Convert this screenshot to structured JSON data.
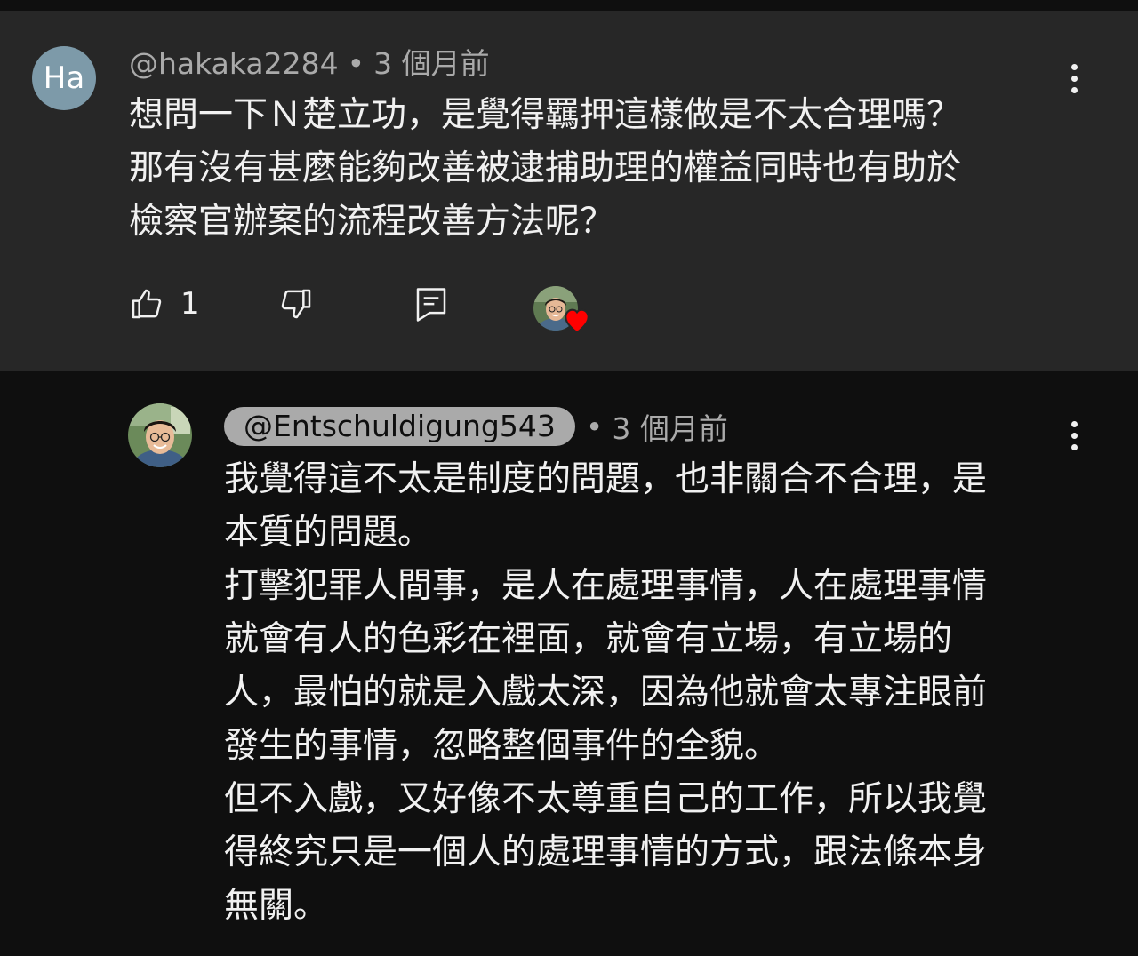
{
  "parent_comment": {
    "avatar_initials": "Ha",
    "author": "@hakaka2284",
    "separator": "•",
    "time": "3 個月前",
    "text": "想問一下Ｎ楚立功，是覺得羈押這樣做是不太合理嗎？\n那有沒有甚麼能夠改善被逮捕助理的權益同時也有助於\n檢察官辦案的流程改善方法呢？",
    "like_count": "1",
    "icons": {
      "like": "thumbs-up-icon",
      "dislike": "thumbs-down-icon",
      "reply": "reply-icon",
      "more": "more-vertical-icon",
      "creator_heart": "heart-icon"
    }
  },
  "reply_comment": {
    "author": "@Entschuldigung543",
    "separator": "•",
    "time": "3 個月前",
    "text": "我覺得這不太是制度的問題，也非關合不合理，是\n本質的問題。\n打擊犯罪人間事，是人在處理事情，人在處理事情\n就會有人的色彩在裡面，就會有立場，有立場的\n人，最怕的就是入戲太深，因為他就會太專注眼前\n發生的事情，忽略整個事件的全貌。\n但不入戲，又好像不太尊重自己的工作，所以我覺\n得終究只是一個人的處理事情的方式，跟法條本身\n無關。",
    "icons": {
      "more": "more-vertical-icon"
    }
  },
  "colors": {
    "parent_bg": "#272727",
    "page_bg": "#0f0f0f",
    "text_primary": "#f1f1f1",
    "text_secondary": "#aaaaaa",
    "avatar_bg": "#7d9aa9",
    "heart": "#ff0000"
  }
}
